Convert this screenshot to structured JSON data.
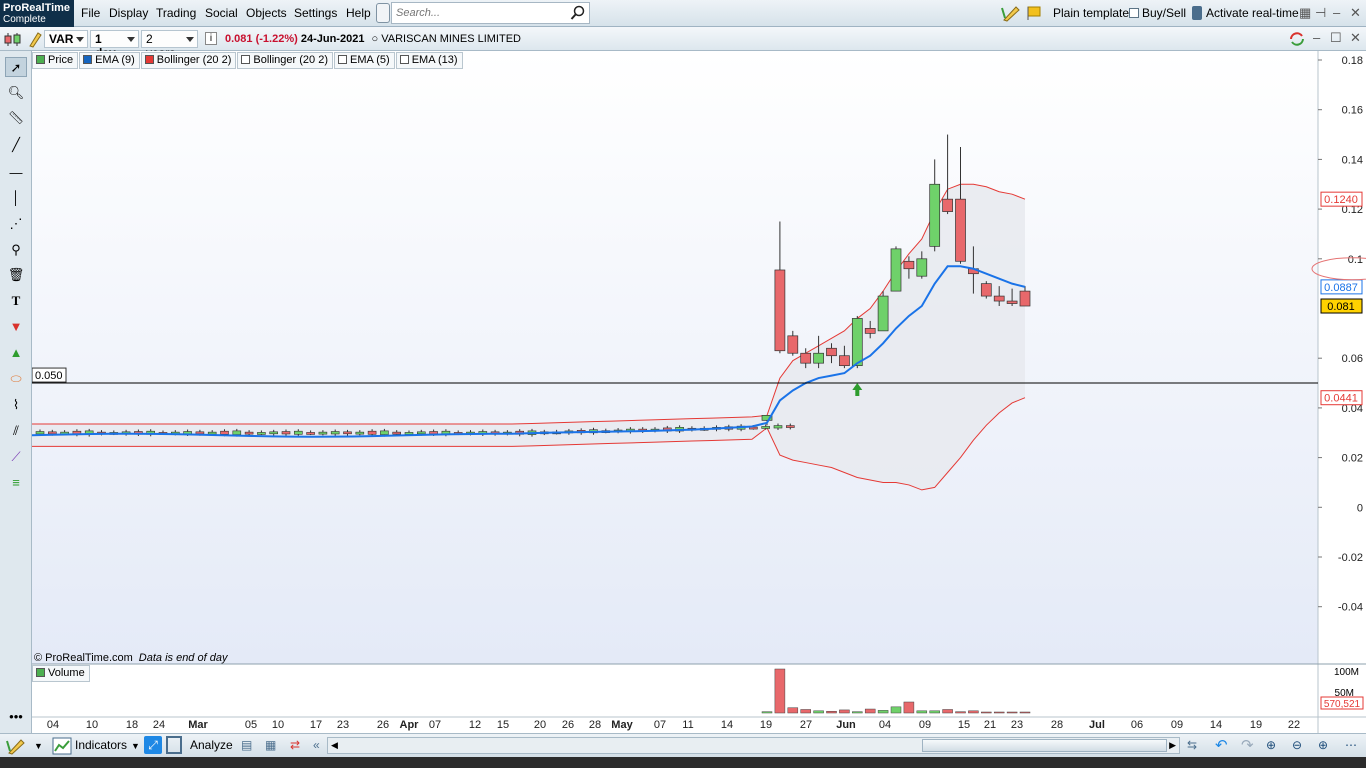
{
  "app": {
    "name": "ProRealTime",
    "edition": "Complete"
  },
  "menu": [
    "File",
    "Display",
    "Trading",
    "Social",
    "Objects",
    "Settings",
    "Help"
  ],
  "search": {
    "placeholder": "Search..."
  },
  "topright": {
    "template": "Plain template",
    "buysell": "Buy/Sell",
    "realtime": "Activate real-time"
  },
  "toolbar": {
    "ticker": "VAR",
    "interval": "1 day",
    "range": "2 years",
    "price": "0.081",
    "change": "(-1.22%)",
    "date": "24-Jun-2021",
    "instrument": "VARISCAN MINES LIMITED"
  },
  "legend": [
    {
      "label": "Price",
      "color": "#4caf50"
    },
    {
      "label": "EMA (9)",
      "color": "#1565c0"
    },
    {
      "label": "Bollinger (20 2)",
      "color": "#e53935"
    },
    {
      "label": "Bollinger (20 2)",
      "color": "#ffffff"
    },
    {
      "label": "EMA (5)",
      "color": "#ffffff"
    },
    {
      "label": "EMA (13)",
      "color": "#ffffff"
    }
  ],
  "volume_legend": {
    "label": "Volume",
    "color": "#4caf50"
  },
  "copyright": "© ProRealTime.com",
  "eod_note": "Data is end of day",
  "hline_label": "0.050",
  "bottom": {
    "indicators": "Indicators",
    "analyze": "Analyze"
  },
  "chart_data": {
    "type": "candlestick",
    "colors": {
      "up": "#6fd16a",
      "down": "#e8686b",
      "ema": "#1a73e8",
      "bollinger": "#e53935",
      "band_fill": "#e8eaf0",
      "hline": "#000000"
    },
    "y_ticks": [
      "0.18",
      "0.16",
      "0.14",
      "0.12",
      "0.1",
      "0.06",
      "0.04",
      "0.02",
      "0",
      "-0.02",
      "-0.04"
    ],
    "ylim": [
      -0.06,
      0.18
    ],
    "x_ticks": [
      "04",
      "10",
      "18",
      "24",
      "Mar",
      "05",
      "10",
      "17",
      "23",
      "26",
      "Apr",
      "07",
      "12",
      "15",
      "20",
      "26",
      "28",
      "May",
      "07",
      "11",
      "14",
      "19",
      "27",
      "Jun",
      "04",
      "09",
      "15",
      "21",
      "23",
      "28",
      "Jul",
      "06",
      "09",
      "14",
      "19",
      "22"
    ],
    "price_labels": [
      {
        "value": "0.1240",
        "color": "#e53935"
      },
      {
        "value": "0.0887",
        "color": "#1a73e8"
      },
      {
        "value": "0.081",
        "color": "#000000"
      },
      {
        "value": "0.0441",
        "color": "#e53935"
      }
    ],
    "horizontal_line": 0.05,
    "volume_ticks": [
      "100M",
      "50M"
    ],
    "volume_label": "570,521",
    "candles_early": {
      "level": 0.03,
      "count": 62
    },
    "candles_late": [
      {
        "o": 0.035,
        "h": 0.037,
        "l": 0.033,
        "c": 0.037
      },
      {
        "o": 0.0955,
        "h": 0.115,
        "l": 0.062,
        "c": 0.063
      },
      {
        "o": 0.069,
        "h": 0.071,
        "l": 0.061,
        "c": 0.062
      },
      {
        "o": 0.062,
        "h": 0.064,
        "l": 0.056,
        "c": 0.058
      },
      {
        "o": 0.058,
        "h": 0.069,
        "l": 0.056,
        "c": 0.062
      },
      {
        "o": 0.064,
        "h": 0.066,
        "l": 0.058,
        "c": 0.061
      },
      {
        "o": 0.061,
        "h": 0.065,
        "l": 0.056,
        "c": 0.057
      },
      {
        "o": 0.057,
        "h": 0.077,
        "l": 0.056,
        "c": 0.076
      },
      {
        "o": 0.072,
        "h": 0.075,
        "l": 0.068,
        "c": 0.07
      },
      {
        "o": 0.071,
        "h": 0.087,
        "l": 0.071,
        "c": 0.085
      },
      {
        "o": 0.087,
        "h": 0.105,
        "l": 0.087,
        "c": 0.104
      },
      {
        "o": 0.099,
        "h": 0.101,
        "l": 0.092,
        "c": 0.096
      },
      {
        "o": 0.093,
        "h": 0.103,
        "l": 0.092,
        "c": 0.1
      },
      {
        "o": 0.105,
        "h": 0.14,
        "l": 0.103,
        "c": 0.13
      },
      {
        "o": 0.124,
        "h": 0.15,
        "l": 0.118,
        "c": 0.119
      },
      {
        "o": 0.124,
        "h": 0.145,
        "l": 0.098,
        "c": 0.099
      },
      {
        "o": 0.096,
        "h": 0.105,
        "l": 0.086,
        "c": 0.094
      },
      {
        "o": 0.09,
        "h": 0.091,
        "l": 0.084,
        "c": 0.085
      },
      {
        "o": 0.085,
        "h": 0.089,
        "l": 0.081,
        "c": 0.083
      },
      {
        "o": 0.083,
        "h": 0.088,
        "l": 0.081,
        "c": 0.082
      },
      {
        "o": 0.087,
        "h": 0.089,
        "l": 0.081,
        "c": 0.081
      }
    ],
    "ema9": [
      0.034,
      0.043,
      0.047,
      0.05,
      0.052,
      0.053,
      0.054,
      0.058,
      0.061,
      0.066,
      0.072,
      0.077,
      0.081,
      0.09,
      0.097,
      0.097,
      0.096,
      0.094,
      0.092,
      0.09,
      0.0887
    ],
    "boll_upper": [
      0.037,
      0.052,
      0.059,
      0.062,
      0.065,
      0.068,
      0.071,
      0.076,
      0.08,
      0.087,
      0.095,
      0.102,
      0.108,
      0.119,
      0.128,
      0.13,
      0.13,
      0.129,
      0.127,
      0.126,
      0.124
    ],
    "boll_lower": [
      0.032,
      0.021,
      0.019,
      0.018,
      0.017,
      0.016,
      0.014,
      0.012,
      0.011,
      0.01,
      0.01,
      0.009,
      0.007,
      0.008,
      0.014,
      0.02,
      0.027,
      0.033,
      0.038,
      0.042,
      0.0441
    ],
    "volumes_late_millions": [
      3,
      100,
      12,
      8,
      5,
      4,
      7,
      3,
      9,
      6,
      14,
      25,
      5,
      5,
      8,
      3,
      5,
      2,
      1,
      1,
      1
    ]
  }
}
